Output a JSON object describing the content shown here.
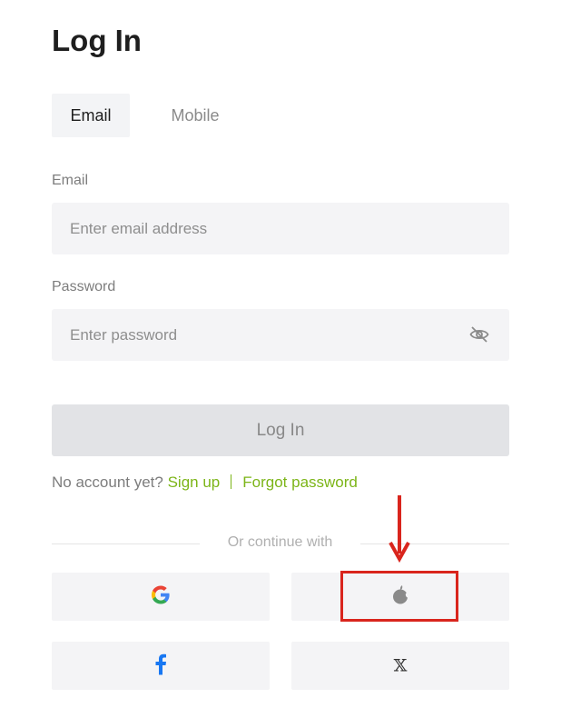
{
  "page": {
    "title": "Log In"
  },
  "tabs": [
    {
      "label": "Email",
      "active": true
    },
    {
      "label": "Mobile",
      "active": false
    }
  ],
  "email": {
    "label": "Email",
    "placeholder": "Enter email address",
    "value": ""
  },
  "password": {
    "label": "Password",
    "placeholder": "Enter password",
    "value": "",
    "toggle_icon": "eye-off-icon"
  },
  "login_button": {
    "label": "Log In"
  },
  "links": {
    "prompt": "No account yet?",
    "signup": "Sign up",
    "forgot": "Forgot password"
  },
  "divider": {
    "text": "Or continue with"
  },
  "social_buttons": [
    {
      "provider": "google",
      "icon": "google-icon"
    },
    {
      "provider": "apple",
      "icon": "apple-icon"
    },
    {
      "provider": "facebook",
      "icon": "facebook-icon"
    },
    {
      "provider": "x",
      "icon": "x-icon",
      "glyph": "𝕏"
    }
  ],
  "annotation": {
    "color": "#d9251d",
    "target": "apple"
  },
  "colors": {
    "accent": "#7cb518",
    "field_bg": "#f4f4f6",
    "disabled_button": "#e2e3e6"
  }
}
